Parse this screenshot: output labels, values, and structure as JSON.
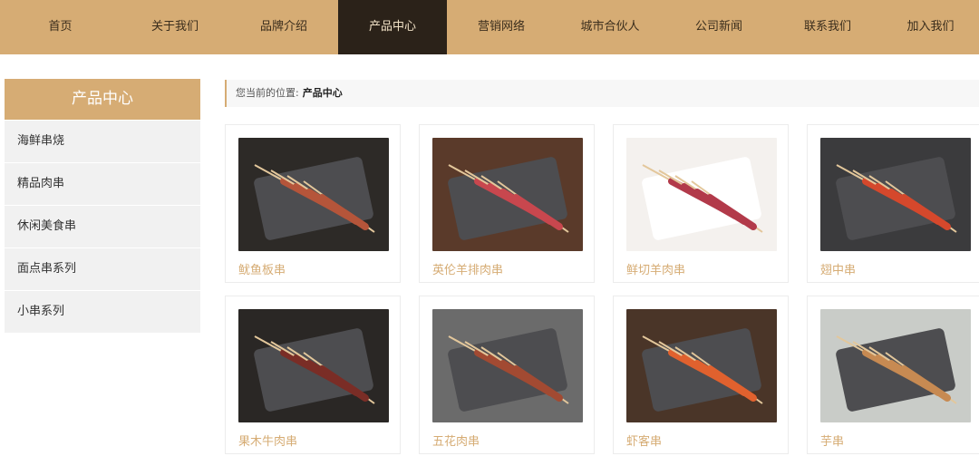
{
  "nav": {
    "items": [
      {
        "label": "首页"
      },
      {
        "label": "关于我们"
      },
      {
        "label": "品牌介绍"
      },
      {
        "label": "产品中心",
        "active": true
      },
      {
        "label": "营销网络"
      },
      {
        "label": "城市合伙人"
      },
      {
        "label": "公司新闻"
      },
      {
        "label": "联系我们"
      },
      {
        "label": "加入我们"
      }
    ]
  },
  "sidebar": {
    "title": "产品中心",
    "items": [
      {
        "label": "海鲜串烧"
      },
      {
        "label": "精品肉串"
      },
      {
        "label": "休闲美食串"
      },
      {
        "label": "面点串系列"
      },
      {
        "label": "小串系列"
      }
    ]
  },
  "breadcrumb": {
    "prefix": "您当前的位置:",
    "current": "产品中心"
  },
  "products": [
    {
      "name": "鱿鱼板串",
      "bg": "#2d2a27",
      "food": "#b5553a"
    },
    {
      "name": "英伦羊排肉串",
      "bg": "#5a3a2a",
      "food": "#c8474e"
    },
    {
      "name": "鲜切羊肉串",
      "bg": "#f4f1ee",
      "food": "#b23a4a"
    },
    {
      "name": "翅中串",
      "bg": "#3b3b3d",
      "food": "#d5482c"
    },
    {
      "name": "果木牛肉串",
      "bg": "#2a2725",
      "food": "#7a2d26"
    },
    {
      "name": "五花肉串",
      "bg": "#6b6b6b",
      "food": "#a24a32"
    },
    {
      "name": "虾客串",
      "bg": "#4a3528",
      "food": "#e0612e"
    },
    {
      "name": "芋串",
      "bg": "#c9ccc8",
      "food": "#c78a52"
    }
  ],
  "colors": {
    "accent": "#d6ac74",
    "nav_active": "#2b2219"
  }
}
